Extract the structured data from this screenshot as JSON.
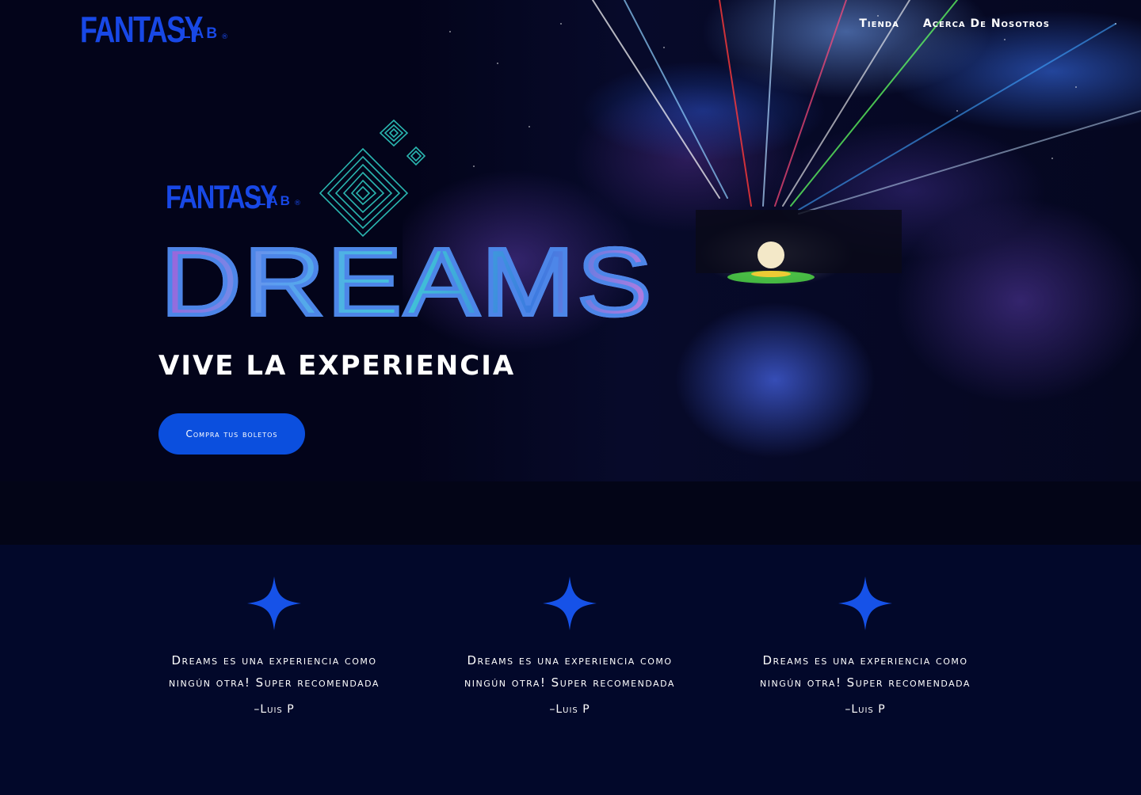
{
  "header": {
    "logo": {
      "wordmark": "FANTASY",
      "sub": "LAB",
      "mark": "®"
    },
    "nav": [
      {
        "label": "Tienda"
      },
      {
        "label": "Acerca De Nosotros"
      }
    ]
  },
  "hero": {
    "brand": {
      "wordmark": "FANTASY",
      "sub": "LAB",
      "mark": "®"
    },
    "title": "DREAMS",
    "tagline": "VIVE LA EXPERIENCIA",
    "cta_label": "Compra tus boletos"
  },
  "testimonials": [
    {
      "quote": "Dreams es una experiencia como ningún otra! Super recomendada",
      "author": "–Luis P",
      "icon": "sparkle-star-icon"
    },
    {
      "quote": "Dreams es una experiencia como ningún otra! Super recomendada",
      "author": "–Luis P",
      "icon": "sparkle-star-icon"
    },
    {
      "quote": "Dreams es una experiencia como ningún otra! Super recomendada",
      "author": "–Luis P",
      "icon": "sparkle-star-icon"
    }
  ],
  "colors": {
    "background": "#030517",
    "brand_blue": "#1848e6",
    "cta_blue": "#0b4fde",
    "testimonial_bg": "#02082a",
    "star": "#1652e8"
  }
}
